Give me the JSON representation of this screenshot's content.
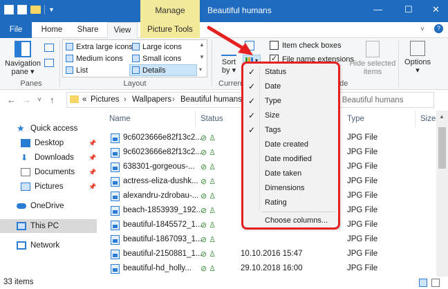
{
  "window": {
    "title": "Beautiful humans",
    "context_tab": "Manage",
    "controls": [
      "—",
      "☐",
      "✕"
    ]
  },
  "tabs": [
    "File",
    "Home",
    "Share",
    "View",
    "Picture Tools"
  ],
  "ribbon": {
    "panes": {
      "navigation_pane": "Navigation\npane ▾",
      "label": "Panes"
    },
    "layout": {
      "items": [
        "Extra large icons",
        "Large icons",
        "Medium icons",
        "Small icons",
        "List",
        "Details"
      ],
      "label": "Layout"
    },
    "current_view": {
      "sort_by": "Sort\nby ▾",
      "label": "Current"
    },
    "show_hide": {
      "item_check_boxes": "Item check boxes",
      "file_name_extensions": "File name extensions",
      "hide_selected_items": "Hide selected\nitems",
      "label_fragment": "ide"
    },
    "options": "Options\n▾"
  },
  "address": {
    "prefix": "«",
    "crumbs": [
      "Pictures",
      "Wallpapers",
      "Beautiful humans"
    ],
    "search_placeholder": "h Beautiful humans"
  },
  "navpane": [
    {
      "label": "Quick access",
      "icon": "star-icon",
      "selected": false
    },
    {
      "label": "Desktop",
      "icon": "desktop-icon",
      "pinned": true
    },
    {
      "label": "Downloads",
      "icon": "downloads-icon",
      "pinned": true
    },
    {
      "label": "Documents",
      "icon": "documents-icon",
      "pinned": true
    },
    {
      "label": "Pictures",
      "icon": "pictures-icon",
      "pinned": true
    },
    {
      "label": "OneDrive",
      "icon": "cloud-icon"
    },
    {
      "label": "This PC",
      "icon": "computer-icon",
      "selected": true
    },
    {
      "label": "Network",
      "icon": "network-icon"
    }
  ],
  "columns": {
    "name": "Name",
    "status": "Status",
    "type": "Type",
    "size": "Size"
  },
  "files": [
    {
      "name": "9c6023666e82f13c2...",
      "date": "",
      "type": "JPG File"
    },
    {
      "name": "9c6023666e82f13c2...",
      "date": "",
      "type": "JPG File"
    },
    {
      "name": "638301-gorgeous-...",
      "date": "",
      "type": "JPG File"
    },
    {
      "name": "actress-eliza-dushk...",
      "date": "",
      "type": "JPG File"
    },
    {
      "name": "alexandru-zdrobau-...",
      "date": "",
      "type": "JPG File"
    },
    {
      "name": "beach-1853939_192...",
      "date": "",
      "type": "JPG File"
    },
    {
      "name": "beautiful-1845572_1...",
      "date": "",
      "type": "JPG File"
    },
    {
      "name": "beautiful-1867093_1...",
      "date": "",
      "type": "JPG File"
    },
    {
      "name": "beautiful-2150881_1...",
      "date": "10.10.2016 15:47",
      "type": "JPG File"
    },
    {
      "name": "beautiful-hd_holly...",
      "date": "29.10.2018 16:00",
      "type": "JPG File"
    }
  ],
  "context_menu": {
    "items": [
      {
        "label": "Status",
        "checked": true
      },
      {
        "label": "Date",
        "checked": true
      },
      {
        "label": "Type",
        "checked": true
      },
      {
        "label": "Size",
        "checked": true
      },
      {
        "label": "Tags",
        "checked": true
      },
      {
        "label": "Date created",
        "checked": false
      },
      {
        "label": "Date modified",
        "checked": false
      },
      {
        "label": "Date taken",
        "checked": false
      },
      {
        "label": "Dimensions",
        "checked": false
      },
      {
        "label": "Rating",
        "checked": false
      }
    ],
    "choose_columns": "Choose columns..."
  },
  "statusbar": {
    "item_count": "33 items"
  },
  "colors": {
    "titlebar": "#1e6bbf",
    "manage": "#f3e99a",
    "highlight": "#e52020"
  }
}
